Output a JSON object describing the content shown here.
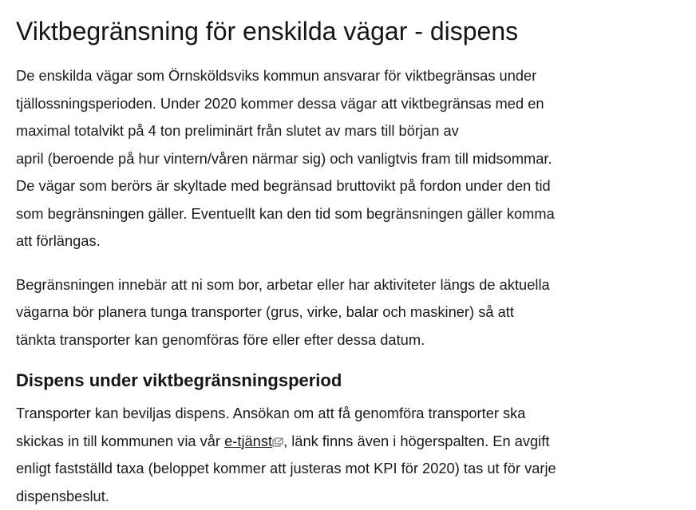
{
  "article": {
    "title": "Viktbegränsning för enskilda vägar - dispens",
    "para1": {
      "lines": [
        "De enskilda vägar som Örnsköldsviks kommun ansvarar för viktbegränsas under",
        "tjällossningsperioden. Under 2020 kommer dessa vägar att viktbegränsas med en",
        "maximal totalvikt på 4 ton preliminärt från slutet av mars till början av",
        "april (beroende på hur vintern/våren närmar sig) och vanligtvis fram till midsommar.",
        "De vägar som berörs är skyltade med begränsad bruttovikt på fordon under den tid",
        "som begränsningen gäller. Eventuellt kan den tid som begränsningen gäller komma",
        "att förlängas."
      ]
    },
    "para2": {
      "lines": [
        "Begränsningen innebär att ni som bor, arbetar eller har aktiviteter längs de aktuella",
        "vägarna bör planera tunga transporter (grus, virke, balar och maskiner) så att",
        "tänkta transporter kan genomföras före eller efter dessa datum."
      ]
    },
    "section_heading": "Dispens under viktbegränsningsperiod",
    "para3": {
      "line1": "Transporter kan beviljas dispens. Ansökan om att få genomföra transporter ska",
      "line2_before": "skickas in till kommunen via vår ",
      "link_text": "e-tjänst",
      "line2_after": ", länk finns även i högerspalten. En avgift",
      "line3": "enligt fastställd taxa (beloppet kommer att justeras mot KPI för 2020) tas ut för varje",
      "line4": "dispensbeslut."
    },
    "icons": {
      "external_link": "external-link-icon"
    }
  }
}
